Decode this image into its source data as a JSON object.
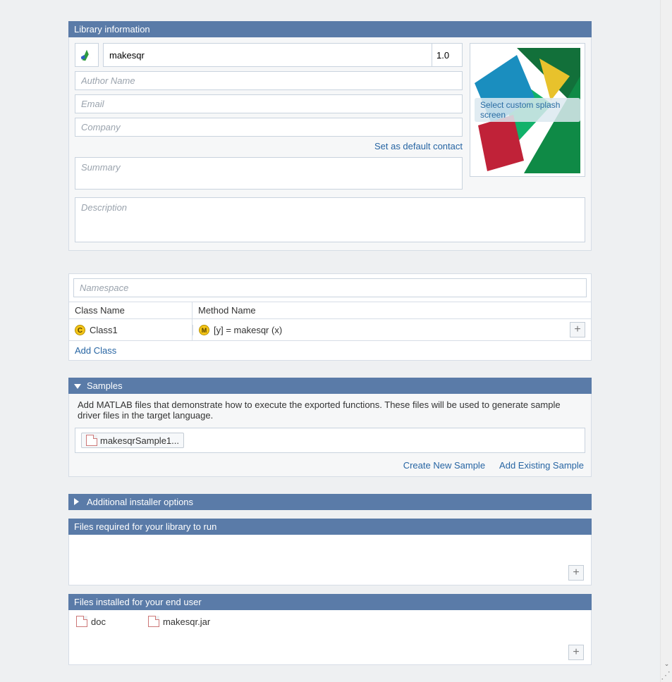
{
  "lib_info": {
    "header": "Library information",
    "name": "makesqr",
    "version": "1.0",
    "author_ph": "Author Name",
    "email_ph": "Email",
    "company_ph": "Company",
    "default_contact_link": "Set as default contact",
    "summary_ph": "Summary",
    "description_ph": "Description",
    "splash_label": "Select custom splash screen"
  },
  "classes": {
    "namespace_ph": "Namespace",
    "col_class": "Class Name",
    "col_method": "Method Name",
    "rows": [
      {
        "class_name": "Class1",
        "method": "[y] = makesqr (x)"
      }
    ],
    "add_class": "Add Class"
  },
  "samples": {
    "header": "Samples",
    "text": "Add MATLAB files that demonstrate how to execute the exported functions.  These files will be used to generate sample driver files in the target language.",
    "file": "makesqrSample1...",
    "create_link": "Create New Sample",
    "add_link": "Add Existing Sample"
  },
  "additional": {
    "header": "Additional installer options"
  },
  "req_files": {
    "header": "Files required for your library to run"
  },
  "inst_files": {
    "header": "Files installed for your end user",
    "items": [
      "doc",
      "makesqr.jar"
    ]
  }
}
